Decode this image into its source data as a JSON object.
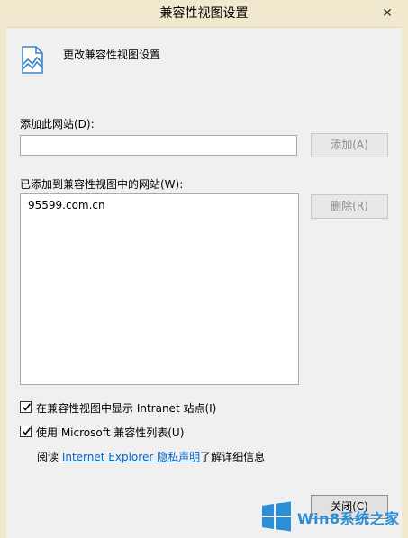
{
  "window": {
    "title": "兼容性视图设置",
    "close_glyph": "✕"
  },
  "header": {
    "icon": "broken-page-icon",
    "text": "更改兼容性视图设置"
  },
  "add_site": {
    "label": "添加此网站(D):",
    "value": "",
    "add_button": "添加(A)"
  },
  "added_sites": {
    "label": "已添加到兼容性视图中的网站(W):",
    "items": [
      "95599.com.cn"
    ],
    "remove_button": "删除(R)"
  },
  "options": {
    "intranet": {
      "label": "在兼容性视图中显示 Intranet 站点(I)",
      "checked": true
    },
    "ms_list": {
      "label": "使用 Microsoft 兼容性列表(U)",
      "checked": true
    }
  },
  "privacy": {
    "prefix": "阅读 ",
    "link": "Internet Explorer 隐私声明",
    "suffix": "了解详细信息"
  },
  "footer": {
    "close_button": "关闭(C)"
  },
  "watermark": {
    "text": "Win8系统之家"
  },
  "colors": {
    "titlebar": "#f0e9ce",
    "link": "#0066cc",
    "watermark": "#2a8fd6"
  }
}
